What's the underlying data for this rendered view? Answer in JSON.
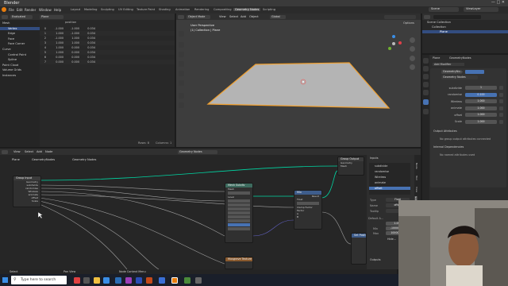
{
  "app": {
    "title": "Blender"
  },
  "menus": [
    "File",
    "Edit",
    "Render",
    "Window",
    "Help"
  ],
  "workspaces": [
    "Layout",
    "Modeling",
    "Sculpting",
    "UV Editing",
    "Texture Paint",
    "Shading",
    "Animation",
    "Rendering",
    "Compositing",
    "Geometry Nodes",
    "Scripting"
  ],
  "active_workspace_index": 9,
  "scene": {
    "scene_name": "Scene",
    "view_layer": "ViewLayer"
  },
  "spreadsheet": {
    "mode": "Evaluated",
    "object": "Plane",
    "column_header": "position",
    "tree": [
      {
        "label": "Mesh",
        "level": 0
      },
      {
        "label": "Vertex",
        "level": 1,
        "selected": true
      },
      {
        "label": "Edge",
        "level": 1
      },
      {
        "label": "Face",
        "level": 1
      },
      {
        "label": "Face Corner",
        "level": 1
      },
      {
        "label": "Curve",
        "level": 0
      },
      {
        "label": "Control Point",
        "level": 1
      },
      {
        "label": "Spline",
        "level": 1
      },
      {
        "label": "Point Cloud",
        "level": 0
      },
      {
        "label": "Volume Grids",
        "level": 0
      },
      {
        "label": "Instances",
        "level": 0
      }
    ],
    "rows": [
      {
        "i": "0",
        "x": "-1.000",
        "y": "-1.000",
        "z": "0.034"
      },
      {
        "i": "1",
        "x": "1.000",
        "y": "-1.000",
        "z": "0.034"
      },
      {
        "i": "2",
        "x": "-1.000",
        "y": "1.000",
        "z": "0.034"
      },
      {
        "i": "3",
        "x": "1.000",
        "y": "1.000",
        "z": "0.034"
      },
      {
        "i": "4",
        "x": "1.000",
        "y": "0.000",
        "z": "0.034"
      },
      {
        "i": "5",
        "x": "1.000",
        "y": "0.000",
        "z": "0.034"
      },
      {
        "i": "6",
        "x": "0.000",
        "y": "0.000",
        "z": "0.034"
      },
      {
        "i": "7",
        "x": "0.000",
        "y": "0.000",
        "z": "0.034"
      }
    ],
    "footer_rows": "Rows: 8",
    "footer_cols": "Columns: 1"
  },
  "viewport": {
    "menu": [
      "Object Mode",
      "View",
      "Select",
      "Add",
      "Object"
    ],
    "orientation": "Global",
    "info_line1": "User Perspective",
    "info_line2": "(1) Collection | Plane",
    "options": "Options"
  },
  "outliner": {
    "items": [
      {
        "label": "Scene Collection",
        "level": 0
      },
      {
        "label": "Collection",
        "level": 1
      },
      {
        "label": "Plane",
        "level": 2,
        "selected": true
      }
    ]
  },
  "properties": {
    "breadcrumb_obj": "Plane",
    "breadcrumb_mod": "GeometryNodes",
    "add_modifier": "Add Modifier",
    "modifier_name": "GeometryNo...",
    "nodegroup": "Geometry Nodes",
    "fields": [
      {
        "label": "subdivide",
        "value": "1"
      },
      {
        "label": "randomise",
        "value": "0.100",
        "active": true
      },
      {
        "label": "Wireless",
        "value": "1.000"
      },
      {
        "label": "animate",
        "value": "1.000"
      },
      {
        "label": "offset",
        "value": "1.000"
      },
      {
        "label": "Scale",
        "value": "1.000"
      }
    ],
    "output_attributes": "Output Attributes",
    "no_group_output": "No group output attributes connected",
    "internal_deps": "Internal Dependencies",
    "no_named": "No named attributes used"
  },
  "node_editor": {
    "menu": [
      "View",
      "Select",
      "Add",
      "Node"
    ],
    "editor_label": "Geometry Nodes",
    "breadcrumb": [
      "Plane",
      "GeometryNodes",
      "Geometry Nodes"
    ],
    "nodes": {
      "group_input": {
        "title": "Group Input",
        "rows": [
          "Geometry",
          "subdivide",
          "randomise",
          "Wireless",
          "animate",
          "offset",
          "Scale"
        ]
      },
      "mesh_subdivide": {
        "title": "Mesh Subdiv",
        "rows": [
          "Mesh",
          "",
          "Level",
          "",
          "",
          "",
          "",
          "",
          "",
          "",
          "",
          "",
          "",
          "",
          "",
          ""
        ]
      },
      "math": {
        "title": "Mix",
        "rows": [
          "Result",
          "Float",
          "",
          "Clamp Factor",
          "Factor",
          "",
          "A",
          "B"
        ]
      },
      "group_output": {
        "title": "Group Output",
        "rows": [
          "Geometry",
          "Mesh"
        ]
      },
      "musgrave": {
        "title": "Musgrave Texture",
        "rows": []
      },
      "set_pos": {
        "title": "Set Position",
        "rows": []
      }
    },
    "sidebar": {
      "inputs_title": "Inputs",
      "inputs": [
        "subdivide",
        "randomise",
        "Wireless",
        "animate",
        "offset"
      ],
      "type_label": "Type",
      "type_value": "Float",
      "name_label": "Name",
      "name_value": "offset",
      "tooltip_label": "Tooltip",
      "default_label": "Default A...",
      "default_value": "1.000",
      "min_label": "Min",
      "min_value": "-10000.000",
      "max_label": "Max",
      "max_value": "10000.000",
      "hide_value": "Hide...",
      "outputs_title": "Outputs",
      "tabs": [
        "Node",
        "Tool",
        "View",
        "Group"
      ]
    }
  },
  "status": {
    "select": "Select",
    "panview": "Pan View",
    "node_menu": "Node Context Menu"
  },
  "taskbar": {
    "search_placeholder": "Type here to search"
  },
  "colors": {
    "accent": "#4772b3",
    "selected_orange": "#f0a030",
    "node_geometry": "#00d6a3",
    "node_float": "#a1a1a1",
    "node_vector": "#6363c7"
  }
}
